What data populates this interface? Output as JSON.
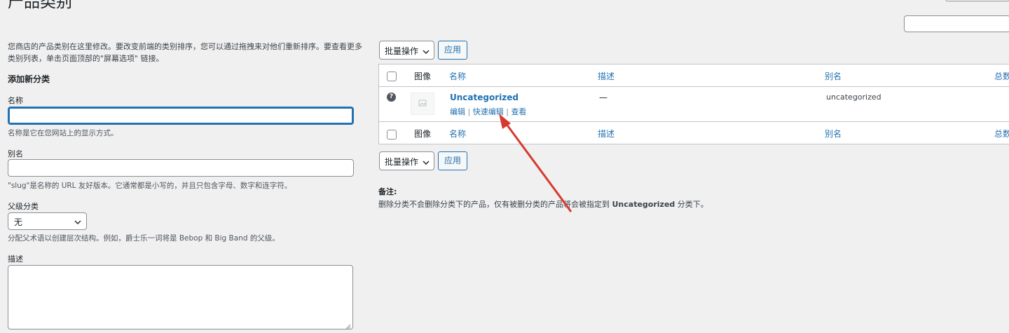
{
  "page": {
    "title": "产品类别"
  },
  "search": {
    "placeholder": ""
  },
  "left": {
    "intro": "您商店的产品类别在这里修改。要改变前端的类别排序，您可以通过拖拽来对他们重新排序。要查看更多类别列表，单击页面顶部的\"屏幕选项\" 链接。",
    "heading": "添加新分类",
    "name_label": "名称",
    "name_value": "",
    "name_hint": "名称是它在您网站上的显示方式。",
    "slug_label": "别名",
    "slug_value": "",
    "slug_hint": "\"slug\"是名称的 URL 友好版本。它通常都是小写的，并且只包含字母、数字和连字符。",
    "parent_label": "父级分类",
    "parent_selected": "无",
    "parent_hint": "分配父术语以创建层次结构。例如，爵士乐一词将是 Bebop 和 Big Band 的父级。",
    "desc_label": "描述",
    "desc_value": ""
  },
  "bulk_top": {
    "label": "批量操作",
    "apply": "应用"
  },
  "bulk_bottom": {
    "label": "批量操作",
    "apply": "应用"
  },
  "table": {
    "columns": {
      "image": "图像",
      "name": "名称",
      "desc": "描述",
      "slug": "别名",
      "count": "总数"
    },
    "row": {
      "help": "?",
      "name": "Uncategorized",
      "desc": "—",
      "slug": "uncategorized",
      "actions": {
        "edit": "编辑",
        "quick": "快速编辑",
        "view": "查看",
        "sep": "|"
      }
    }
  },
  "note": {
    "label": "备注:",
    "text_prefix": "删除分类不会删除分类下的产品，仅有被删分类的产品将会被指定到 ",
    "text_bold": "Uncategorized",
    "text_suffix": " 分类下。"
  },
  "colors": {
    "accent": "#2271b1",
    "arrow": "#d63a2f"
  },
  "icons": {
    "select": "chevron-down-icon",
    "help": "question-circle-icon",
    "image": "image-placeholder-icon",
    "arrow": "annotation-arrow"
  }
}
